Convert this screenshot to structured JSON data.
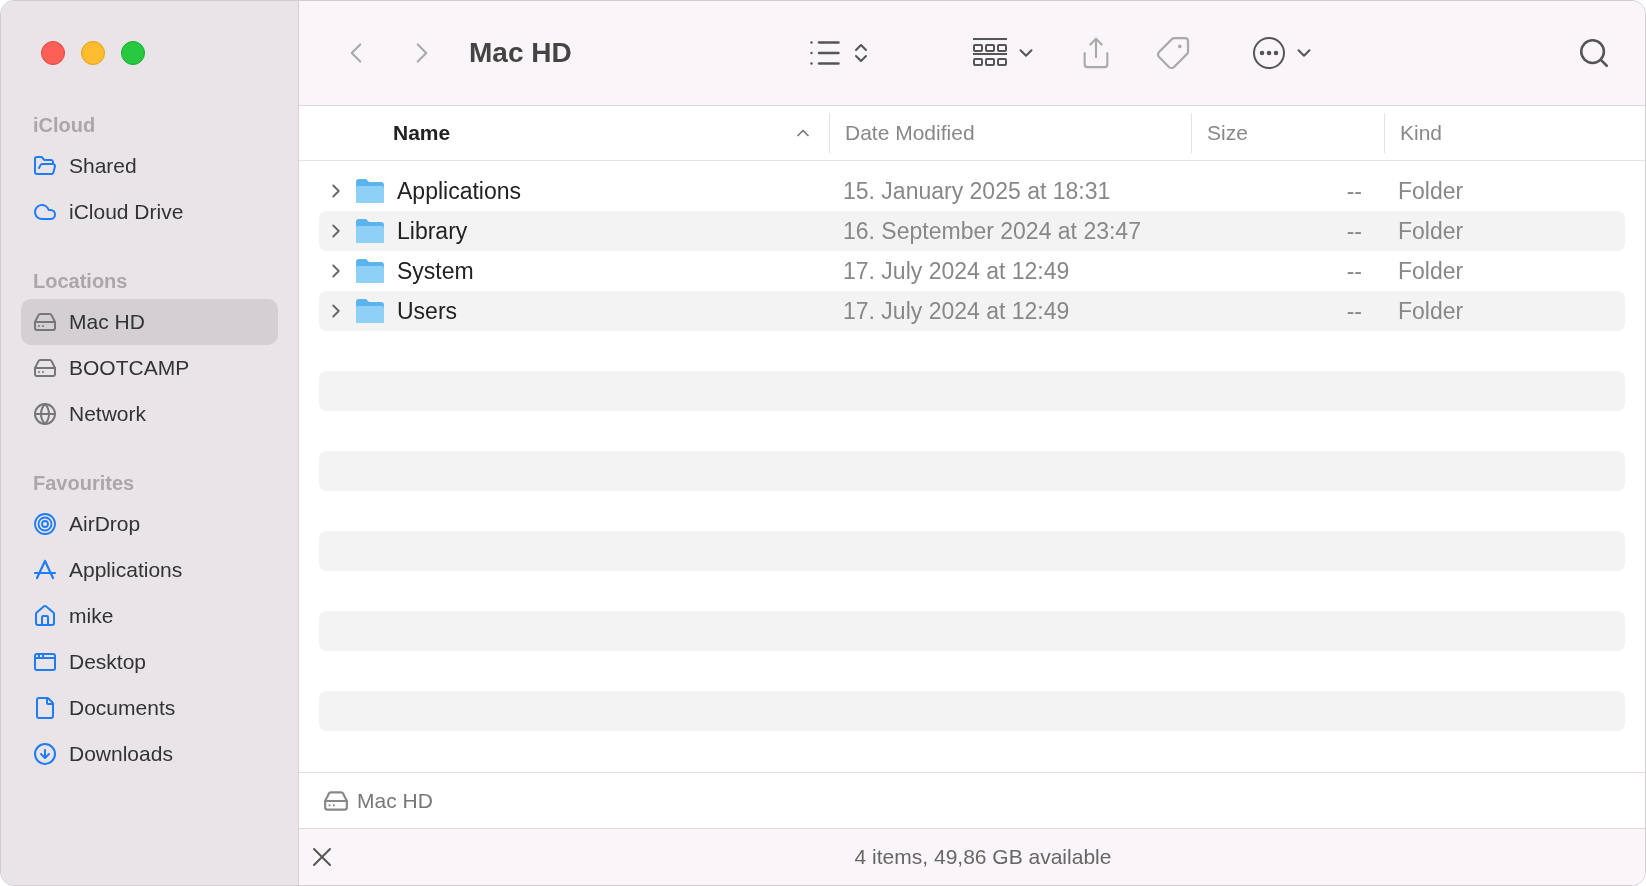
{
  "window": {
    "title": "Mac HD"
  },
  "sidebar": {
    "sections": [
      {
        "title": "iCloud",
        "items": [
          {
            "label": "Shared",
            "selected": false
          },
          {
            "label": "iCloud Drive",
            "selected": false
          }
        ]
      },
      {
        "title": "Locations",
        "items": [
          {
            "label": "Mac HD",
            "selected": true
          },
          {
            "label": "BOOTCAMP",
            "selected": false
          },
          {
            "label": "Network",
            "selected": false
          }
        ]
      },
      {
        "title": "Favourites",
        "items": [
          {
            "label": "AirDrop",
            "selected": false
          },
          {
            "label": "Applications",
            "selected": false
          },
          {
            "label": "mike",
            "selected": false
          },
          {
            "label": "Desktop",
            "selected": false
          },
          {
            "label": "Documents",
            "selected": false
          },
          {
            "label": "Downloads",
            "selected": false
          }
        ]
      }
    ]
  },
  "table": {
    "columns": [
      {
        "label": "Name",
        "sorted": true
      },
      {
        "label": "Date Modified",
        "sorted": false
      },
      {
        "label": "Size",
        "sorted": false
      },
      {
        "label": "Kind",
        "sorted": false
      }
    ],
    "rows": [
      {
        "name": "Applications",
        "date": "15. January 2025 at 18:31",
        "size": "--",
        "kind": "Folder",
        "expanded": false
      },
      {
        "name": "Library",
        "date": "16. September 2024 at 23:47",
        "size": "--",
        "kind": "Folder",
        "expanded": false
      },
      {
        "name": "System",
        "date": "17. July 2024 at 12:49",
        "size": "--",
        "kind": "Folder",
        "expanded": false
      },
      {
        "name": "Users",
        "date": "17. July 2024 at 12:49",
        "size": "--",
        "kind": "Folder",
        "expanded": false
      }
    ]
  },
  "path_bar": {
    "label": "Mac HD"
  },
  "status_bar": {
    "text": "4 items, 49,86 GB available"
  }
}
